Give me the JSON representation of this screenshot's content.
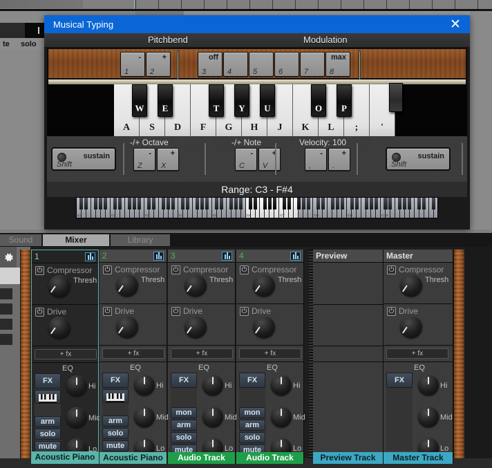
{
  "background": {
    "track_controls": [
      {
        "label": "te"
      },
      {
        "label": "solo"
      }
    ]
  },
  "musical_typing": {
    "title": "Musical Typing",
    "close_icon": "close-icon",
    "sections": {
      "pitchbend_label": "Pitchbend",
      "modulation_label": "Modulation"
    },
    "pitchbend_keys": [
      {
        "top": "-",
        "bottom": "1"
      },
      {
        "top": "+",
        "bottom": "2"
      }
    ],
    "modulation_keys": [
      {
        "top": "off",
        "bottom": "3"
      },
      {
        "top": "",
        "bottom": "4"
      },
      {
        "top": "",
        "bottom": "5"
      },
      {
        "top": "",
        "bottom": "6"
      },
      {
        "top": "",
        "bottom": "7"
      },
      {
        "top": "max",
        "bottom": "8"
      }
    ],
    "white_keys": [
      "A",
      "S",
      "D",
      "F",
      "G",
      "H",
      "J",
      "K",
      "L",
      ";",
      "'"
    ],
    "black_keys": [
      "W",
      "E",
      "T",
      "Y",
      "U",
      "O",
      "P"
    ],
    "controls": {
      "sustain_left": {
        "label": "sustain",
        "key": "Shift"
      },
      "sustain_right": {
        "label": "sustain",
        "key": "Shift"
      },
      "octave_label": "-/+ Octave",
      "octave_keys": [
        {
          "top": "-",
          "bottom": "Z"
        },
        {
          "top": "+",
          "bottom": "X"
        }
      ],
      "note_label": "-/+ Note",
      "note_keys": [
        {
          "top": "-",
          "bottom": "C"
        },
        {
          "top": "+",
          "bottom": "V"
        }
      ],
      "velocity_label": "Velocity: 100",
      "velocity_keys": [
        {
          "top": "-",
          "bottom": ","
        },
        {
          "top": "+",
          "bottom": "."
        }
      ]
    },
    "range_text": "Range: C3 - F#4",
    "mini_keyboard_octave_labels": [
      "C1",
      "C2",
      "C3",
      "C4",
      "C5",
      "C6",
      "C7",
      "C8",
      "C9",
      "C10"
    ]
  },
  "mixer": {
    "tabs": [
      {
        "label": "Sound",
        "active": false
      },
      {
        "label": "Mixer",
        "active": true
      },
      {
        "label": "Library",
        "active": false
      }
    ],
    "gear_icon": "gear-icon",
    "plugin_labels": {
      "compressor": "Compressor",
      "compressor_knob": "Thresh",
      "drive": "Drive",
      "add_fx": "+ fx",
      "eq": "EQ",
      "eq_hi": "Hi",
      "eq_mid": "Mid",
      "eq_lo": "Lo",
      "fx": "FX",
      "keyboard_icon": "keyboard-icon"
    },
    "channels": [
      {
        "number": "1",
        "name": "Acoustic Piano",
        "color": "#5ab5a8",
        "selected": true,
        "has_plugins": true,
        "has_mon": false,
        "buttons": [
          "arm",
          "solo",
          "mute"
        ],
        "has_kbd": true
      },
      {
        "number": "2",
        "name": "Acoustic Piano",
        "color": "#5ab5a8",
        "selected": false,
        "has_plugins": true,
        "has_mon": false,
        "buttons": [
          "arm",
          "solo",
          "mute"
        ],
        "has_kbd": true
      },
      {
        "number": "3",
        "name": "Audio Track",
        "color": "#1f9e4a",
        "selected": false,
        "has_plugins": true,
        "has_mon": true,
        "buttons": [
          "mon",
          "arm",
          "solo",
          "mute"
        ],
        "has_kbd": false
      },
      {
        "number": "4",
        "name": "Audio Track",
        "color": "#1f9e4a",
        "selected": false,
        "has_plugins": true,
        "has_mon": true,
        "buttons": [
          "mon",
          "arm",
          "solo",
          "mute"
        ],
        "has_kbd": false
      }
    ],
    "preview": {
      "header": "Preview",
      "name": "Preview Track",
      "color": "#3ca8c4"
    },
    "master": {
      "header": "Master",
      "name": "Master Track",
      "color": "#3ca8c4"
    }
  }
}
